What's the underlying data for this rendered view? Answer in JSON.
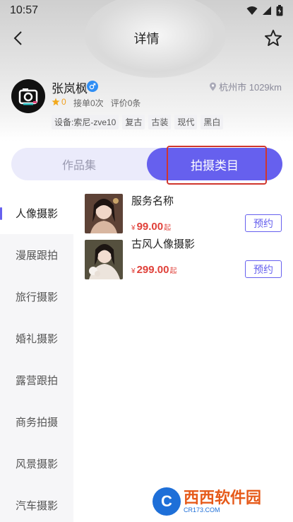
{
  "status": {
    "time": "10:57"
  },
  "nav": {
    "title": "详情"
  },
  "profile": {
    "name": "张岚枫",
    "location": "杭州市 1029km",
    "rating": "0",
    "orders": "接单0次",
    "reviews": "评价0条",
    "tags": [
      "设备:索尼-zve10",
      "复古",
      "古装",
      "现代",
      "黑白"
    ]
  },
  "tabs": {
    "portfolio": "作品集",
    "categories": "拍摄类目"
  },
  "categories": [
    "人像摄影",
    "漫展跟拍",
    "旅行摄影",
    "婚礼摄影",
    "露营跟拍",
    "商务拍摄",
    "风景摄影",
    "汽车摄影"
  ],
  "services": [
    {
      "title": "服务名称",
      "currency": "¥",
      "price": "99.00",
      "suffix": "起",
      "button": "预约"
    },
    {
      "title": "古风人像摄影",
      "currency": "¥",
      "price": "299.00",
      "suffix": "起",
      "button": "预约"
    }
  ],
  "watermark": {
    "logo_letter": "C",
    "main": "西西软件园",
    "sub": "CR173.COM"
  },
  "colors": {
    "accent": "#6660ee",
    "price": "#e0413a",
    "highlight": "#d0362d"
  }
}
